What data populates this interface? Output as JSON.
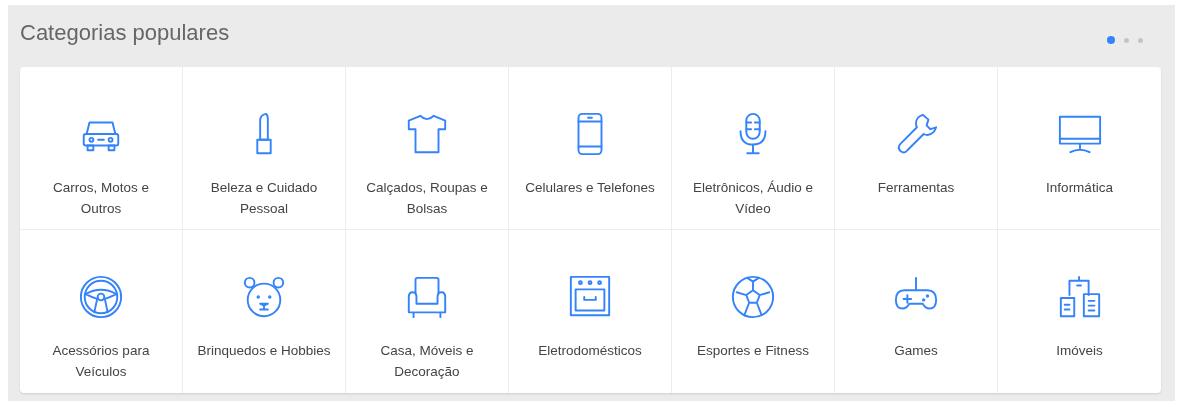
{
  "section": {
    "title": "Categorias populares"
  },
  "pager": [
    {
      "selected": true
    },
    {
      "selected": false
    },
    {
      "selected": false
    }
  ],
  "categories": [
    {
      "label": "Carros, Motos e Outros"
    },
    {
      "label": "Beleza e Cuidado Pessoal"
    },
    {
      "label": "Calçados, Roupas e Bolsas"
    },
    {
      "label": "Celulares e Telefones"
    },
    {
      "label": "Eletrônicos, Áudio e Vídeo"
    },
    {
      "label": "Ferramentas"
    },
    {
      "label": "Informática"
    },
    {
      "label": "Acessórios para Veículos"
    },
    {
      "label": "Brinquedos e Hobbies"
    },
    {
      "label": "Casa, Móveis e Decoração"
    },
    {
      "label": "Eletrodomésticos"
    },
    {
      "label": "Esportes e Fitness"
    },
    {
      "label": "Games"
    },
    {
      "label": "Imóveis"
    }
  ]
}
